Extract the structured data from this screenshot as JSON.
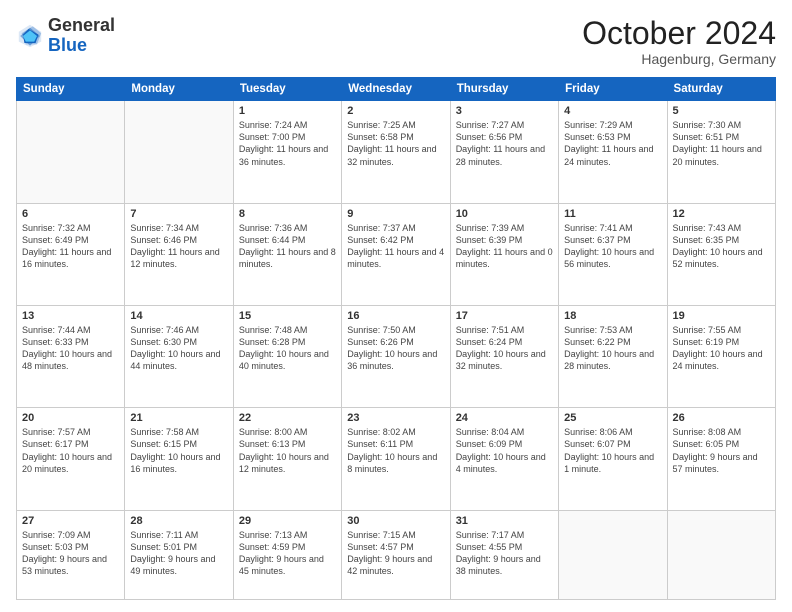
{
  "header": {
    "logo": {
      "general": "General",
      "blue": "Blue"
    },
    "month": "October 2024",
    "location": "Hagenburg, Germany"
  },
  "days": [
    "Sunday",
    "Monday",
    "Tuesday",
    "Wednesday",
    "Thursday",
    "Friday",
    "Saturday"
  ],
  "weeks": [
    [
      {
        "day": "",
        "info": ""
      },
      {
        "day": "",
        "info": ""
      },
      {
        "day": "1",
        "info": "Sunrise: 7:24 AM\nSunset: 7:00 PM\nDaylight: 11 hours and 36 minutes."
      },
      {
        "day": "2",
        "info": "Sunrise: 7:25 AM\nSunset: 6:58 PM\nDaylight: 11 hours and 32 minutes."
      },
      {
        "day": "3",
        "info": "Sunrise: 7:27 AM\nSunset: 6:56 PM\nDaylight: 11 hours and 28 minutes."
      },
      {
        "day": "4",
        "info": "Sunrise: 7:29 AM\nSunset: 6:53 PM\nDaylight: 11 hours and 24 minutes."
      },
      {
        "day": "5",
        "info": "Sunrise: 7:30 AM\nSunset: 6:51 PM\nDaylight: 11 hours and 20 minutes."
      }
    ],
    [
      {
        "day": "6",
        "info": "Sunrise: 7:32 AM\nSunset: 6:49 PM\nDaylight: 11 hours and 16 minutes."
      },
      {
        "day": "7",
        "info": "Sunrise: 7:34 AM\nSunset: 6:46 PM\nDaylight: 11 hours and 12 minutes."
      },
      {
        "day": "8",
        "info": "Sunrise: 7:36 AM\nSunset: 6:44 PM\nDaylight: 11 hours and 8 minutes."
      },
      {
        "day": "9",
        "info": "Sunrise: 7:37 AM\nSunset: 6:42 PM\nDaylight: 11 hours and 4 minutes."
      },
      {
        "day": "10",
        "info": "Sunrise: 7:39 AM\nSunset: 6:39 PM\nDaylight: 11 hours and 0 minutes."
      },
      {
        "day": "11",
        "info": "Sunrise: 7:41 AM\nSunset: 6:37 PM\nDaylight: 10 hours and 56 minutes."
      },
      {
        "day": "12",
        "info": "Sunrise: 7:43 AM\nSunset: 6:35 PM\nDaylight: 10 hours and 52 minutes."
      }
    ],
    [
      {
        "day": "13",
        "info": "Sunrise: 7:44 AM\nSunset: 6:33 PM\nDaylight: 10 hours and 48 minutes."
      },
      {
        "day": "14",
        "info": "Sunrise: 7:46 AM\nSunset: 6:30 PM\nDaylight: 10 hours and 44 minutes."
      },
      {
        "day": "15",
        "info": "Sunrise: 7:48 AM\nSunset: 6:28 PM\nDaylight: 10 hours and 40 minutes."
      },
      {
        "day": "16",
        "info": "Sunrise: 7:50 AM\nSunset: 6:26 PM\nDaylight: 10 hours and 36 minutes."
      },
      {
        "day": "17",
        "info": "Sunrise: 7:51 AM\nSunset: 6:24 PM\nDaylight: 10 hours and 32 minutes."
      },
      {
        "day": "18",
        "info": "Sunrise: 7:53 AM\nSunset: 6:22 PM\nDaylight: 10 hours and 28 minutes."
      },
      {
        "day": "19",
        "info": "Sunrise: 7:55 AM\nSunset: 6:19 PM\nDaylight: 10 hours and 24 minutes."
      }
    ],
    [
      {
        "day": "20",
        "info": "Sunrise: 7:57 AM\nSunset: 6:17 PM\nDaylight: 10 hours and 20 minutes."
      },
      {
        "day": "21",
        "info": "Sunrise: 7:58 AM\nSunset: 6:15 PM\nDaylight: 10 hours and 16 minutes."
      },
      {
        "day": "22",
        "info": "Sunrise: 8:00 AM\nSunset: 6:13 PM\nDaylight: 10 hours and 12 minutes."
      },
      {
        "day": "23",
        "info": "Sunrise: 8:02 AM\nSunset: 6:11 PM\nDaylight: 10 hours and 8 minutes."
      },
      {
        "day": "24",
        "info": "Sunrise: 8:04 AM\nSunset: 6:09 PM\nDaylight: 10 hours and 4 minutes."
      },
      {
        "day": "25",
        "info": "Sunrise: 8:06 AM\nSunset: 6:07 PM\nDaylight: 10 hours and 1 minute."
      },
      {
        "day": "26",
        "info": "Sunrise: 8:08 AM\nSunset: 6:05 PM\nDaylight: 9 hours and 57 minutes."
      }
    ],
    [
      {
        "day": "27",
        "info": "Sunrise: 7:09 AM\nSunset: 5:03 PM\nDaylight: 9 hours and 53 minutes."
      },
      {
        "day": "28",
        "info": "Sunrise: 7:11 AM\nSunset: 5:01 PM\nDaylight: 9 hours and 49 minutes."
      },
      {
        "day": "29",
        "info": "Sunrise: 7:13 AM\nSunset: 4:59 PM\nDaylight: 9 hours and 45 minutes."
      },
      {
        "day": "30",
        "info": "Sunrise: 7:15 AM\nSunset: 4:57 PM\nDaylight: 9 hours and 42 minutes."
      },
      {
        "day": "31",
        "info": "Sunrise: 7:17 AM\nSunset: 4:55 PM\nDaylight: 9 hours and 38 minutes."
      },
      {
        "day": "",
        "info": ""
      },
      {
        "day": "",
        "info": ""
      }
    ]
  ]
}
